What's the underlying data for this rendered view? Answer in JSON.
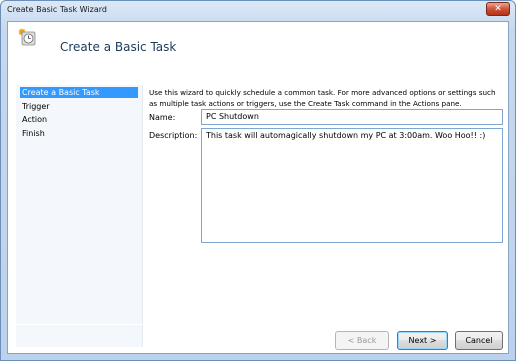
{
  "window": {
    "title": "Create Basic Task Wizard",
    "close_glyph": "✕"
  },
  "header": {
    "title": "Create a Basic Task",
    "icon": "scheduled-task-clock-icon"
  },
  "nav": {
    "items": [
      {
        "label": "Create a Basic Task",
        "selected": true
      },
      {
        "label": "Trigger"
      },
      {
        "label": "Action"
      },
      {
        "label": "Finish"
      }
    ]
  },
  "main": {
    "intro": "Use this wizard to quickly schedule a common task.  For more advanced options or settings such as multiple task actions or triggers, use the Create Task command in the Actions pane.",
    "name_label": "Name:",
    "name_value": "PC Shutdown",
    "description_label": "Description:",
    "description_value": "This task will automagically shutdown my PC at 3:00am.  Woo Hoo!!  :)"
  },
  "footer": {
    "back_label": "< Back",
    "next_label": "Next >",
    "cancel_label": "Cancel"
  },
  "colors": {
    "selection": "#3399ff",
    "frame": "#c6d8ee",
    "close": "#c94d33"
  }
}
